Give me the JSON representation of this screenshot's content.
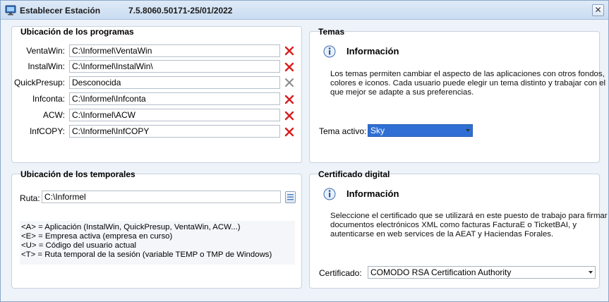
{
  "window": {
    "title": "Establecer Estación",
    "version": "7.5.8060.50171-25/01/2022",
    "close_label": "✕"
  },
  "programs": {
    "title": "Ubicación de los programas",
    "rows": [
      {
        "label": "VentaWin:",
        "value": "C:\\Informel\\VentaWin",
        "clear_enabled": true
      },
      {
        "label": "InstalWin:",
        "value": "C:\\Informel\\InstalWin\\",
        "clear_enabled": true
      },
      {
        "label": "QuickPresup:",
        "value": "Desconocida",
        "clear_enabled": false
      },
      {
        "label": "Infconta:",
        "value": "C:\\Informel\\Infconta",
        "clear_enabled": true
      },
      {
        "label": "ACW:",
        "value": "C:\\Informel\\ACW",
        "clear_enabled": true
      },
      {
        "label": "InfCOPY:",
        "value": "C:\\Informel\\InfCOPY",
        "clear_enabled": true
      }
    ]
  },
  "temporales": {
    "title": "Ubicación de los temporales",
    "ruta_label": "Ruta:",
    "ruta_value": "C:\\Informel",
    "legend": [
      "<A> = Aplicación (InstalWin, QuickPresup, VentaWin, ACW...)",
      "<E> = Empresa activa (empresa en curso)",
      "<U> = Código del usuario actual",
      "<T> = Ruta temporal de la sesión (variable TEMP o TMP de Windows)"
    ]
  },
  "temas": {
    "title": "Temas",
    "info_title": "Información",
    "info_lines": [
      "Los temas permiten cambiar el aspecto de las aplicaciones con otros fondos,",
      "colores e iconos. Cada usuario puede elegir un tema distinto y trabajar con el",
      "que mejor se adapte a sus preferencias."
    ],
    "tema_label": "Tema activo:",
    "tema_value": "Sky"
  },
  "certificado": {
    "title": "Certificado digital",
    "info_title": "Información",
    "info_lines": [
      "Seleccione el certificado que se  utilizará en este puesto de trabajo para firmar",
      "documentos electrónicos XML como facturas FacturaE o TicketBAI, y",
      "autenticarse en web services de la AEAT y Haciendas Forales."
    ],
    "cert_label": "Certificado:",
    "cert_value": "COMODO RSA Certification Authority"
  },
  "colors": {
    "accent_selected": "#2f6fd3",
    "clear_red": "#d91e1e",
    "clear_gray": "#8a8a8a"
  },
  "icons": {
    "app": "monitor-icon",
    "clear": "red-x-icon",
    "info": "info-icon",
    "browse": "folder-browse-icon"
  }
}
